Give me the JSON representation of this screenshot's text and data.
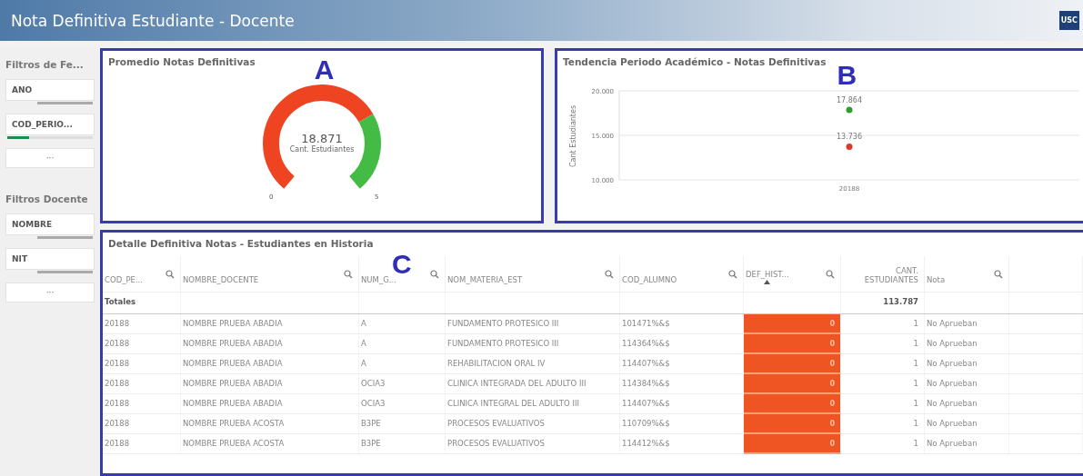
{
  "window": {
    "title": "Nota Definitiva Estudiante - Docente",
    "logo": "USC"
  },
  "sidebar": {
    "groups": [
      {
        "title": "Filtros de Fe...",
        "filters": [
          {
            "label": "ANO"
          },
          {
            "label": "COD_PERIO...",
            "level": 0.25
          }
        ],
        "more": "···"
      },
      {
        "title": "Filtros Docente",
        "filters": [
          {
            "label": "NOMBRE"
          },
          {
            "label": "NIT"
          }
        ],
        "more": "···"
      }
    ]
  },
  "gauge_panel": {
    "title": "Promedio Notas Definitivas",
    "marker": "A",
    "value": "18.871",
    "caption": "Cant. Estudiantes",
    "min_label": "0",
    "max_label": "5"
  },
  "trend_panel": {
    "title": "Tendencia Periodo Académico - Notas Definitivas",
    "marker": "B",
    "chart_data": {
      "type": "scatter",
      "ylabel": "Cant Estudiantes",
      "categories": [
        "20188"
      ],
      "series": [
        {
          "color": "#2e9e2e",
          "values": [
            17864
          ]
        },
        {
          "color": "#d93a2a",
          "values": [
            13736
          ]
        }
      ],
      "value_labels": [
        "17.864",
        "13.736"
      ],
      "ylim": [
        10000,
        20000
      ],
      "yticks": [
        {
          "value": 10000,
          "label": "10.000"
        },
        {
          "value": 15000,
          "label": "15.000"
        },
        {
          "value": 20000,
          "label": "20.000"
        }
      ]
    }
  },
  "table_panel": {
    "title": "Detalle Definitiva Notas - Estudiantes en Historia",
    "marker": "C",
    "columns": [
      {
        "label": "COD_PE...",
        "search": true,
        "kind": "dimension"
      },
      {
        "label": "NOMBRE_DOCENTE",
        "search": true,
        "kind": "dimension"
      },
      {
        "label": "NUM_G...",
        "search": true,
        "kind": "dimension"
      },
      {
        "label": "NOM_MATERIA_EST",
        "search": true,
        "kind": "dimension"
      },
      {
        "label": "COD_ALUMNO",
        "search": true,
        "kind": "dimension"
      },
      {
        "label": "DEF_HIST...",
        "search": true,
        "sorted": true,
        "kind": "colored"
      },
      {
        "label": "CANT. ESTUDIANTES",
        "search": false,
        "kind": "measure"
      },
      {
        "label": "Nota",
        "search": true,
        "kind": "dimension"
      }
    ],
    "totals": {
      "label": "Totales",
      "value": "113.787"
    },
    "rows": [
      [
        "20188",
        "NOMBRE PRUEBA ABADIA",
        "A",
        "FUNDAMENTO PROTESICO III",
        "101471%&$",
        "0",
        "1",
        "No Aprueban"
      ],
      [
        "20188",
        "NOMBRE PRUEBA ABADIA",
        "A",
        "FUNDAMENTO PROTESICO III",
        "114364%&$",
        "0",
        "1",
        "No Aprueban"
      ],
      [
        "20188",
        "NOMBRE PRUEBA ABADIA",
        "A",
        "REHABILITACION ORAL IV",
        "114407%&$",
        "0",
        "1",
        "No Aprueban"
      ],
      [
        "20188",
        "NOMBRE PRUEBA ABADIA",
        "OCIA3",
        "CLINICA INTEGRADA DEL ADULTO III",
        "114384%&$",
        "0",
        "1",
        "No Aprueban"
      ],
      [
        "20188",
        "NOMBRE PRUEBA ABADIA",
        "OCIA3",
        "CLINICA INTEGRAL DEL ADULTO III",
        "114407%&$",
        "0",
        "1",
        "No Aprueban"
      ],
      [
        "20188",
        "NOMBRE PRUEBA ACOSTA",
        "B3PE",
        "PROCESOS EVALUATIVOS",
        "110709%&$",
        "0",
        "1",
        "No Aprueban"
      ],
      [
        "20188",
        "NOMBRE PRUEBA ACOSTA",
        "B3PE",
        "PROCESOS EVALUATIVOS",
        "114412%&$",
        "0",
        "1",
        "No Aprueban"
      ]
    ]
  }
}
